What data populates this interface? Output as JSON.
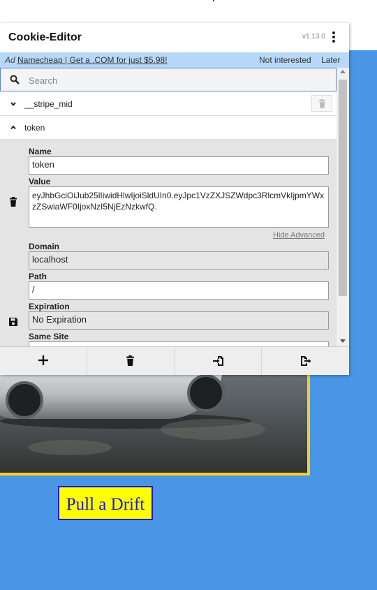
{
  "popup": {
    "title": "Cookie-Editor",
    "version": "v1.13.0"
  },
  "ad": {
    "label": "Ad",
    "link_text": "Namecheap | Get a .COM for just $5.98!",
    "not_interested": "Not interested",
    "later": "Later"
  },
  "search": {
    "placeholder": "Search",
    "value": ""
  },
  "cookies": [
    {
      "name": "__stripe_mid",
      "expanded": false
    },
    {
      "name": "token",
      "expanded": true
    }
  ],
  "detail": {
    "name_label": "Name",
    "name_value": "token",
    "value_label": "Value",
    "value_value": "eyJhbGciOiJub25lIiwidHlwIjoiSldUIn0.eyJpc1VzZXJSZWdpc3RlcmVkIjpmYWxzZSwiaWF0IjoxNzI5NjEzNzkwfQ.",
    "hide_advanced": "Hide Advanced",
    "domain_label": "Domain",
    "domain_value": "localhost",
    "path_label": "Path",
    "path_value": "/",
    "expiration_label": "Expiration",
    "expiration_value": "No Expiration",
    "samesite_label": "Same Site"
  },
  "toolbar": {
    "icons": [
      "plus-icon",
      "trash-icon",
      "import-icon",
      "export-icon"
    ]
  },
  "page": {
    "button_label": "Pull a Drift",
    "button_bg": "#ffff00",
    "button_fg": "#1a1ad0",
    "background": "#4a95e5",
    "frame_color": "#f3d21d"
  }
}
